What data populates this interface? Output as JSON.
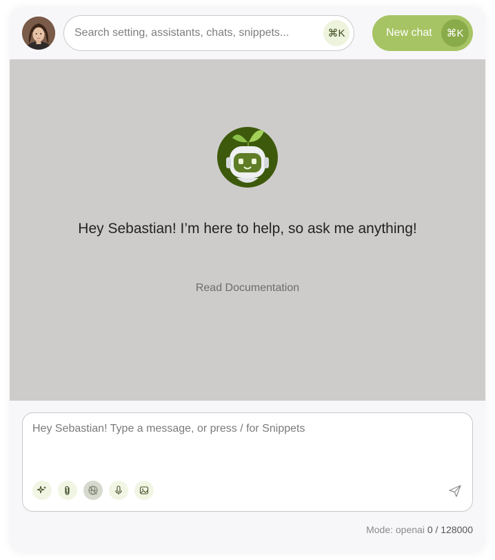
{
  "header": {
    "search": {
      "placeholder": "Search setting, assistants, chats, snippets...",
      "shortcut": "⌘K"
    },
    "new_chat": {
      "label": "New chat",
      "shortcut": "⌘K"
    }
  },
  "main": {
    "greeting": "Hey Sebastian! I’m here to help, so ask me anything!",
    "doc_link": "Read Documentation"
  },
  "composer": {
    "placeholder": "Hey Sebastian! Type a message, or press / for Snippets",
    "tools": [
      {
        "icon": "sparkles-icon"
      },
      {
        "icon": "paperclip-icon"
      },
      {
        "icon": "globe-icon",
        "active": true
      },
      {
        "icon": "microphone-icon"
      },
      {
        "icon": "image-icon"
      }
    ],
    "send_icon": "send-icon"
  },
  "footer": {
    "mode_label": "Mode: openai",
    "token_count": "0 / 128000"
  },
  "colors": {
    "accent": "#a7c464",
    "accent_dark": "#8aab49",
    "main_bg": "#cecccb",
    "bot_bg": "#3d5a0c"
  }
}
